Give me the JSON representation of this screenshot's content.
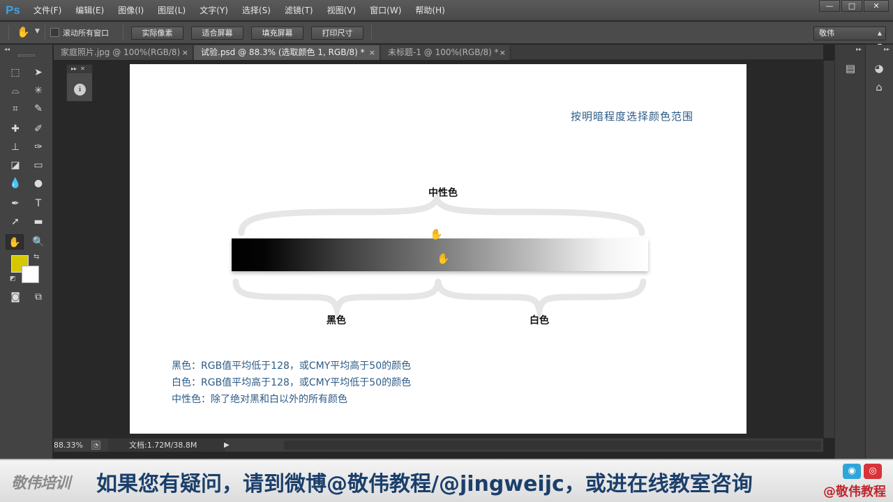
{
  "app": {
    "logo": "Ps"
  },
  "menu": [
    "文件(F)",
    "编辑(E)",
    "图像(I)",
    "图层(L)",
    "文字(Y)",
    "选择(S)",
    "滤镜(T)",
    "视图(V)",
    "窗口(W)",
    "帮助(H)"
  ],
  "window_controls": {
    "minimize": "—",
    "maximize": "□",
    "close": "✕"
  },
  "options": {
    "scroll_all_label": "滚动所有窗口",
    "buttons": [
      "实际像素",
      "适合屏幕",
      "填充屏幕",
      "打印尺寸"
    ],
    "workspace": "敬伟"
  },
  "tabs": [
    {
      "label": "家庭照片.jpg @ 100%(RGB/8)",
      "close": "×",
      "active": false
    },
    {
      "label": "试验.psd @ 88.3% (选取颜色 1, RGB/8) *",
      "close": "×",
      "active": true
    },
    {
      "label": "未标题-1 @ 100%(RGB/8) *",
      "close": "×",
      "active": false
    }
  ],
  "canvas": {
    "title": "按明暗程度选择颜色范围",
    "neutral_label": "中性色",
    "black_label": "黑色",
    "white_label": "白色",
    "definitions": [
      "黑色：RGB值平均低于128，或CMY平均高于50的颜色",
      "白色：RGB值平均高于128，或CMY平均低于50的颜色",
      "中性色：除了绝对黑和白以外的所有颜色"
    ]
  },
  "mini_panel": {
    "info": "i"
  },
  "status": {
    "zoom": "88.33%",
    "doc_info": "文档:1.72M/38.8M"
  },
  "colors": {
    "foreground": "#d6c800",
    "background": "#ffffff",
    "accent_text": "#2c5a86"
  },
  "banner": {
    "logo": "敬伟培训",
    "text": "如果您有疑问，请到微博@敬伟教程/@jingweijc，或进在线教室咨询",
    "handle": "@敬伟教程"
  }
}
